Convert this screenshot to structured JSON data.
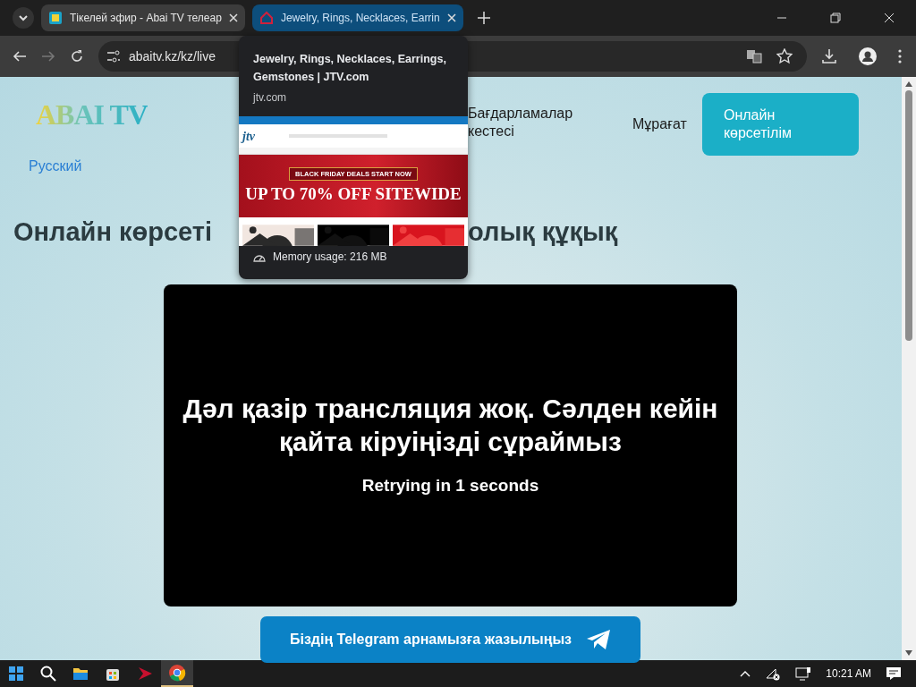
{
  "browser": {
    "tabs": [
      {
        "title": "Тікелей эфир - Abai TV телеар",
        "selected": true,
        "highlighted": false,
        "kind": "abai"
      },
      {
        "title": "Jewelry, Rings, Necklaces, Earrin",
        "selected": false,
        "highlighted": true,
        "kind": "jtv"
      }
    ],
    "address": "abaitv.kz/kz/live"
  },
  "tab_preview": {
    "title": "Jewelry, Rings, Necklaces, Earrings, Gemstones | JTV.com",
    "domain": "jtv.com",
    "thumbnail": {
      "logo": "jtv",
      "banner": "BLACK FRIDAY DEALS START NOW",
      "headline": "UP TO 70% OFF SITEWIDE"
    },
    "memory": "Memory usage: 216 MB"
  },
  "page": {
    "logo": "ABAI TV",
    "language": "Русский",
    "nav": [
      {
        "label": "Бағдарламалар кестесі",
        "kind": "link"
      },
      {
        "label": "Мұрағат",
        "kind": "link"
      },
      {
        "label": "Онлайн көрсетілім",
        "kind": "button"
      }
    ],
    "heading_parts": [
      "Онлайн көрсеті",
      "олық құқық"
    ],
    "player": {
      "message": "Дәл қазір трансляция жоқ. Сәлден кейін қайта кіруіңізді сұраймыз",
      "retry": "Retrying in 1 seconds"
    },
    "telegram_button": "Біздің Telegram арнамызға жазылыңыз"
  },
  "taskbar": {
    "apps": [
      {
        "kind": "start",
        "active": false
      },
      {
        "kind": "search",
        "active": false
      },
      {
        "kind": "explorer",
        "active": false
      },
      {
        "kind": "store",
        "active": false
      },
      {
        "kind": "arrow",
        "active": false
      },
      {
        "kind": "chrome",
        "active": true
      }
    ],
    "clock": "10:21 AM"
  }
}
